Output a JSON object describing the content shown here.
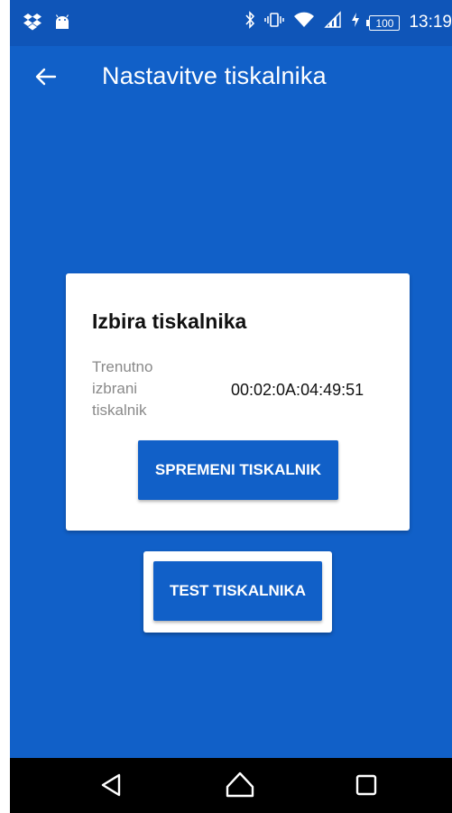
{
  "status_bar": {
    "time": "13:19",
    "battery": "100",
    "left_icons": [
      "dropbox-icon",
      "android-icon"
    ],
    "right_icons": [
      "bluetooth-icon",
      "vibrate-icon",
      "wifi-icon",
      "signal-icon",
      "charging-icon",
      "battery-icon"
    ]
  },
  "app_bar": {
    "title": "Nastavitve tiskalnika",
    "back_icon": "arrow-left-icon"
  },
  "card": {
    "title": "Izbira tiskalnika",
    "current_label": "Trenutno izbrani tiskalnik",
    "current_value": "00:02:0A:04:49:51",
    "change_button": "SPREMENI TISKALNIK"
  },
  "test_button": "TEST TISKALNIKA",
  "nav_bar": {
    "buttons": [
      "back-triangle-icon",
      "home-icon",
      "recents-icon"
    ]
  },
  "colors": {
    "primary": "#1160C8",
    "status_bar": "#0F55B8",
    "nav_bar": "#000000",
    "card": "#FFFFFF"
  }
}
